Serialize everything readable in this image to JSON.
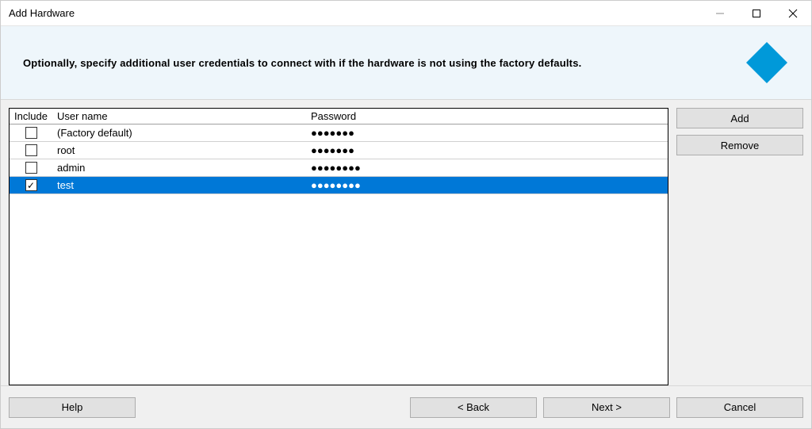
{
  "window": {
    "title": "Add Hardware"
  },
  "header": {
    "subtitle": "Optionally, specify additional user credentials to connect with if the hardware is not using the factory defaults.",
    "logo_color": "#0099d9"
  },
  "table": {
    "columns": {
      "include": "Include",
      "username": "User name",
      "password": "Password"
    },
    "rows": [
      {
        "checked": false,
        "selected": false,
        "username": "(Factory default)",
        "password": "●●●●●●●"
      },
      {
        "checked": false,
        "selected": false,
        "username": "root",
        "password": "●●●●●●●"
      },
      {
        "checked": false,
        "selected": false,
        "username": "admin",
        "password": "●●●●●●●●"
      },
      {
        "checked": true,
        "selected": true,
        "username": "test",
        "password": "●●●●●●●●"
      }
    ]
  },
  "side_buttons": {
    "add": "Add",
    "remove": "Remove"
  },
  "footer": {
    "help": "Help",
    "back": "< Back",
    "next": "Next >",
    "cancel": "Cancel"
  }
}
